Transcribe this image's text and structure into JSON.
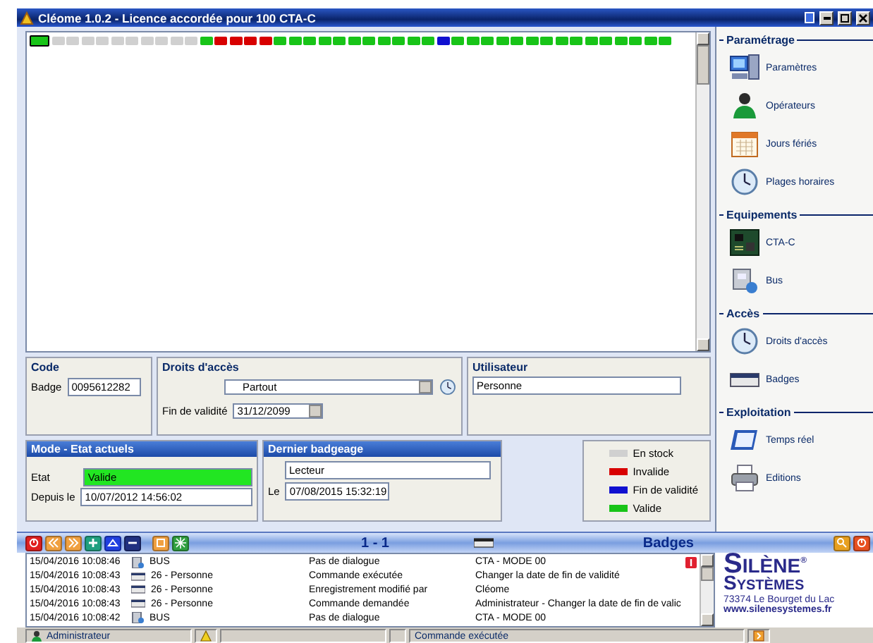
{
  "window": {
    "title": "Cléome 1.0.2 - Licence accordée pour 100 CTA-C"
  },
  "badge_strip": [
    {
      "color": "#18c418",
      "selected": true
    },
    {
      "color": "#d0d0d0",
      "selected": false
    },
    {
      "color": "#d0d0d0",
      "selected": false
    },
    {
      "color": "#d0d0d0",
      "selected": false
    },
    {
      "color": "#d0d0d0",
      "selected": false
    },
    {
      "color": "#d0d0d0",
      "selected": false
    },
    {
      "color": "#d0d0d0",
      "selected": false
    },
    {
      "color": "#d0d0d0",
      "selected": false
    },
    {
      "color": "#d0d0d0",
      "selected": false
    },
    {
      "color": "#d0d0d0",
      "selected": false
    },
    {
      "color": "#d0d0d0",
      "selected": false
    },
    {
      "color": "#18c418",
      "selected": false
    },
    {
      "color": "#d80000",
      "selected": false
    },
    {
      "color": "#d80000",
      "selected": false
    },
    {
      "color": "#d80000",
      "selected": false
    },
    {
      "color": "#d80000",
      "selected": false
    },
    {
      "color": "#18c418",
      "selected": false
    },
    {
      "color": "#18c418",
      "selected": false
    },
    {
      "color": "#18c418",
      "selected": false
    },
    {
      "color": "#18c418",
      "selected": false
    },
    {
      "color": "#18c418",
      "selected": false
    },
    {
      "color": "#18c418",
      "selected": false
    },
    {
      "color": "#18c418",
      "selected": false
    },
    {
      "color": "#18c418",
      "selected": false
    },
    {
      "color": "#18c418",
      "selected": false
    },
    {
      "color": "#18c418",
      "selected": false
    },
    {
      "color": "#18c418",
      "selected": false
    },
    {
      "color": "#1010d0",
      "selected": false
    },
    {
      "color": "#18c418",
      "selected": false
    },
    {
      "color": "#18c418",
      "selected": false
    },
    {
      "color": "#18c418",
      "selected": false
    },
    {
      "color": "#18c418",
      "selected": false
    },
    {
      "color": "#18c418",
      "selected": false
    },
    {
      "color": "#18c418",
      "selected": false
    },
    {
      "color": "#18c418",
      "selected": false
    },
    {
      "color": "#18c418",
      "selected": false
    },
    {
      "color": "#18c418",
      "selected": false
    },
    {
      "color": "#18c418",
      "selected": false
    },
    {
      "color": "#18c418",
      "selected": false
    },
    {
      "color": "#18c418",
      "selected": false
    },
    {
      "color": "#18c418",
      "selected": false
    },
    {
      "color": "#18c418",
      "selected": false
    },
    {
      "color": "#18c418",
      "selected": false
    }
  ],
  "code": {
    "title": "Code",
    "badge_label": "Badge",
    "badge_value": "0095612282"
  },
  "access_rights": {
    "title": "Droits d'accès",
    "profile_value": "Partout",
    "end_label": "Fin de validité",
    "end_value": "31/12/2099"
  },
  "user": {
    "title": "Utilisateur",
    "value": "Personne"
  },
  "mode": {
    "title": "Mode - Etat actuels",
    "state_label": "Etat",
    "state_value": "Valide",
    "since_label": "Depuis le",
    "since_value": "10/07/2012 14:56:02"
  },
  "last_badging": {
    "title": "Dernier badgeage",
    "reader_value": "Lecteur",
    "date_label": "Le",
    "date_value": "07/08/2015 15:32:19"
  },
  "legend": [
    {
      "label": "En stock",
      "color": "#d0d0d0"
    },
    {
      "label": "Invalide",
      "color": "#d80000"
    },
    {
      "label": "Fin de validité",
      "color": "#1010d0"
    },
    {
      "label": "Valide",
      "color": "#18c418"
    }
  ],
  "toolbar": {
    "counter": "1 - 1",
    "title": "Badges"
  },
  "log": [
    {
      "time": "15/04/2016 10:08:46",
      "kind": "bus",
      "source": "BUS",
      "event": "Pas de dialogue",
      "detail": "CTA - MODE 00",
      "alert": true
    },
    {
      "time": "15/04/2016 10:08:43",
      "kind": "badge",
      "source": "26 - Personne",
      "event": "Commande exécutée",
      "detail": "Changer la date de fin de validité",
      "alert": false
    },
    {
      "time": "15/04/2016 10:08:43",
      "kind": "badge",
      "source": "26 - Personne",
      "event": "Enregistrement modifié par",
      "detail": "Cléome",
      "alert": false
    },
    {
      "time": "15/04/2016 10:08:43",
      "kind": "badge",
      "source": "26 - Personne",
      "event": "Commande demandée",
      "detail": "Administrateur - Changer la date de fin de valic",
      "alert": false
    },
    {
      "time": "15/04/2016 10:08:42",
      "kind": "bus",
      "source": "BUS",
      "event": "Pas de dialogue",
      "detail": "CTA - MODE 00",
      "alert": false
    }
  ],
  "sidebar": [
    {
      "title": "Paramétrage",
      "items": [
        {
          "label": "Paramètres",
          "kind": "computer"
        },
        {
          "label": "Opérateurs",
          "kind": "person"
        },
        {
          "label": "Jours fériés",
          "kind": "calendar"
        },
        {
          "label": "Plages horaires",
          "kind": "clock"
        }
      ]
    },
    {
      "title": "Equipements",
      "items": [
        {
          "label": "CTA-C",
          "kind": "board"
        },
        {
          "label": "Bus",
          "kind": "bus"
        }
      ]
    },
    {
      "title": "Accès",
      "items": [
        {
          "label": "Droits d'accès",
          "kind": "clock"
        },
        {
          "label": "Badges",
          "kind": "badge"
        }
      ]
    },
    {
      "title": "Exploitation",
      "items": [
        {
          "label": "Temps réel",
          "kind": "screen"
        },
        {
          "label": "Editions",
          "kind": "printer"
        }
      ]
    }
  ],
  "logo": {
    "name": "SILÈNE",
    "mark": "®",
    "subtitle": "SYSTÈMES",
    "address": "73374 Le Bourget du Lac",
    "url": "www.silenesystemes.fr"
  },
  "status_bar": {
    "user": "Administrateur",
    "message": "Commande exécutée"
  }
}
